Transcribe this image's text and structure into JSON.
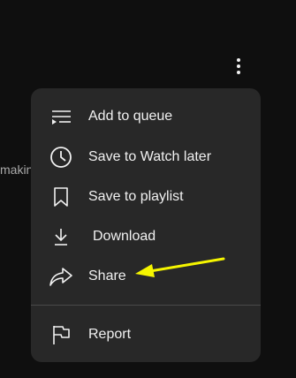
{
  "background": {
    "partial_text": "makin"
  },
  "kebab": {
    "icon": "more-vert-icon"
  },
  "menu": {
    "items": [
      {
        "label": "Add to queue",
        "icon": "queue-icon"
      },
      {
        "label": "Save to Watch later",
        "icon": "clock-icon"
      },
      {
        "label": "Save to playlist",
        "icon": "bookmark-icon"
      },
      {
        "label": "Download",
        "icon": "download-icon"
      },
      {
        "label": "Share",
        "icon": "share-icon"
      },
      {
        "label": "Report",
        "icon": "flag-icon"
      }
    ]
  },
  "colors": {
    "page_background": "#0f0f0f",
    "menu_background": "#282828",
    "text": "#f1f1f1",
    "annotation_arrow": "#f5f500"
  }
}
